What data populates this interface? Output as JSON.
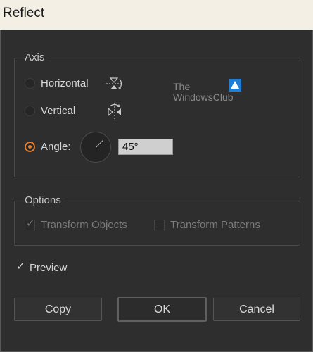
{
  "window": {
    "title": "Reflect"
  },
  "axis": {
    "legend": "Axis",
    "horizontal_label": "Horizontal",
    "vertical_label": "Vertical",
    "angle_label": "Angle:",
    "angle_value": "45°",
    "selected": "angle",
    "dial_angle_degrees": 45
  },
  "watermark": {
    "line1": "The",
    "line2": "WindowsClub"
  },
  "options": {
    "legend": "Options",
    "transform_objects_label": "Transform Objects",
    "transform_objects_checked": true,
    "transform_patterns_label": "Transform Patterns",
    "transform_patterns_checked": false
  },
  "preview": {
    "label": "Preview",
    "checked": true
  },
  "buttons": {
    "copy": "Copy",
    "ok": "OK",
    "cancel": "Cancel"
  },
  "colors": {
    "accent": "#d9823b",
    "panel": "#2e2e2e",
    "titlebar": "#f3efe4"
  }
}
